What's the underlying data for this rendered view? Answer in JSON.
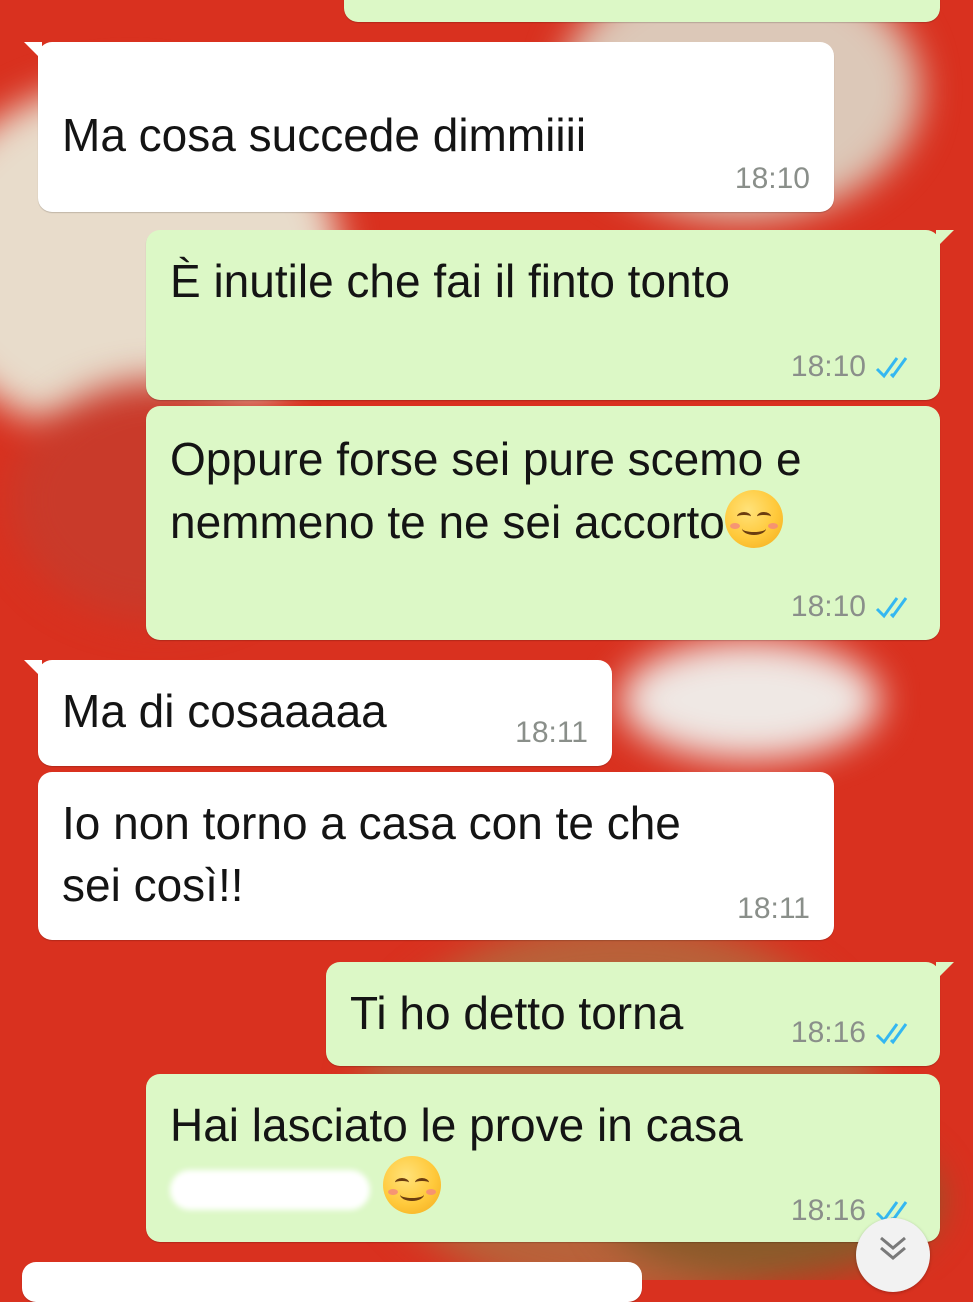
{
  "messages": [
    {
      "text": "Ma cosa succede dimmiiii",
      "time": "18:10"
    },
    {
      "text": "È inutile che fai il finto tonto",
      "time": "18:10"
    },
    {
      "text": "Oppure forse sei pure scemo e\nnemmeno te ne sei accorto",
      "time": "18:10"
    },
    {
      "text": "Ma di cosaaaaa",
      "time": "18:11"
    },
    {
      "text": "Io non torno a casa con te che\nsei così!!",
      "time": "18:11"
    },
    {
      "text": "Ti ho detto torna",
      "time": "18:16"
    },
    {
      "text": "Hai lasciato le prove in casa",
      "time": "18:16"
    }
  ],
  "colors": {
    "incoming_bubble": "#ffffff",
    "outgoing_bubble": "#dcf8c6",
    "read_ticks": "#34b7f1",
    "timestamp": "#8a8f8a"
  },
  "icons": {
    "read_receipt": "double-check-icon",
    "emoji": "smiling-face-icon",
    "scroll": "chevrons-down-icon"
  }
}
